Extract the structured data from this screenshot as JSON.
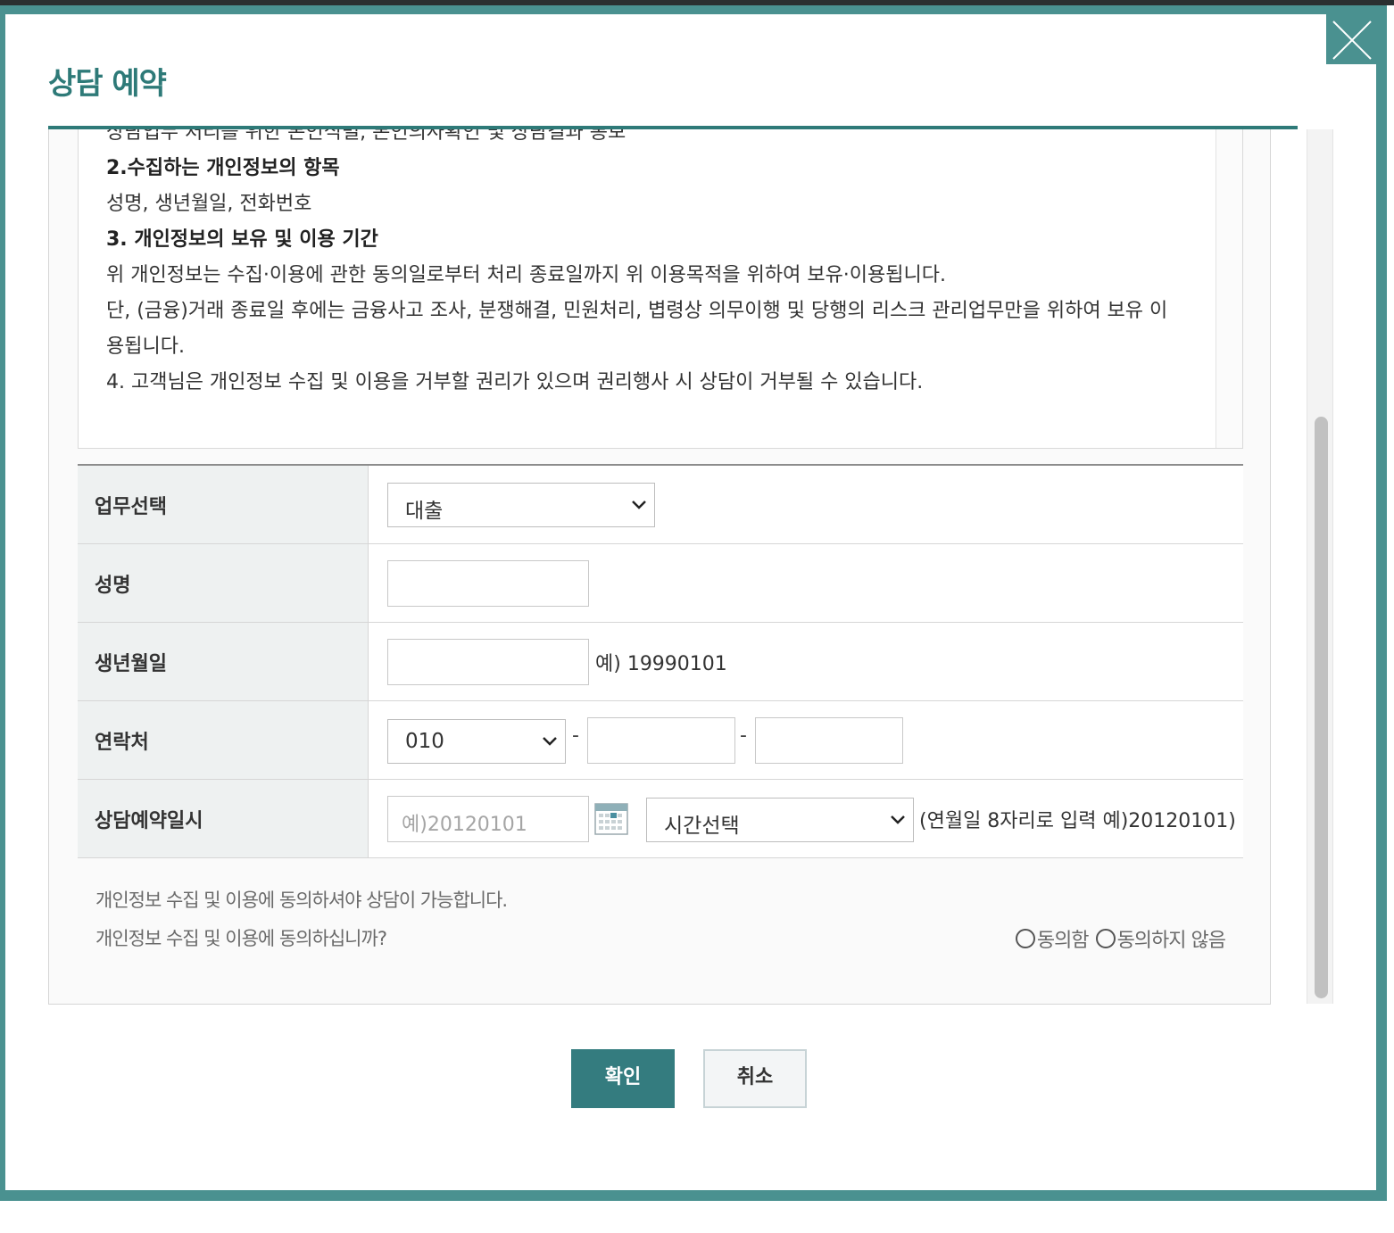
{
  "modal": {
    "title": "상담 예약",
    "close_icon": "close-icon"
  },
  "terms": {
    "cut_line": "상담업무 처리를 위한 본인식별, 본인의사확인 및 상담결과 통보",
    "heading2": "2.수집하는 개인정보의 항목",
    "items2": "성명, 생년월일, 전화번호",
    "heading3": "3. 개인정보의 보유 및 이용 기간",
    "para3a": "위 개인정보는 수집·이용에 관한 동의일로부터 처리 종료일까지 위 이용목적을 위하여 보유·이용됩니다.",
    "para3b_line1": "단, (금융)거래 종료일 후에는 금융사고 조사, 분쟁해결, 민원처리, 볍령상 의무이행 및 당행의 리스크 관리업무만을 위하여 보유 이",
    "para3b_line2": "용됩니다.",
    "para4": "4. 고객님은 개인정보 수집 및 이용을 거부할 권리가 있으며 권리행사 시 상담이 거부될 수 있습니다."
  },
  "form": {
    "business": {
      "label": "업무선택",
      "selected": "대출"
    },
    "name": {
      "label": "성명",
      "value": ""
    },
    "birth": {
      "label": "생년월일",
      "value": "",
      "hint": "예) 19990101"
    },
    "phone": {
      "label": "연락처",
      "prefix": "010",
      "sep1": "-",
      "sep2": "-",
      "middle": "",
      "last": ""
    },
    "appointment": {
      "label": "상담예약일시",
      "date_placeholder": "예)20120101",
      "calendar_icon": "calendar-icon",
      "time_selected": "시간선택",
      "hint": "(연월일 8자리로 입력 예)20120101)"
    }
  },
  "consent": {
    "notice": "개인정보 수집 및 이용에 동의하셔야 상담이 가능합니다.",
    "question": "개인정보 수집 및 이용에 동의하십니까?",
    "agree": "동의함",
    "disagree": "동의하지 않음"
  },
  "buttons": {
    "confirm": "확인",
    "cancel": "취소"
  },
  "colors": {
    "accent": "#2e7a78",
    "frame": "#4a9190",
    "button": "#347c7f"
  }
}
